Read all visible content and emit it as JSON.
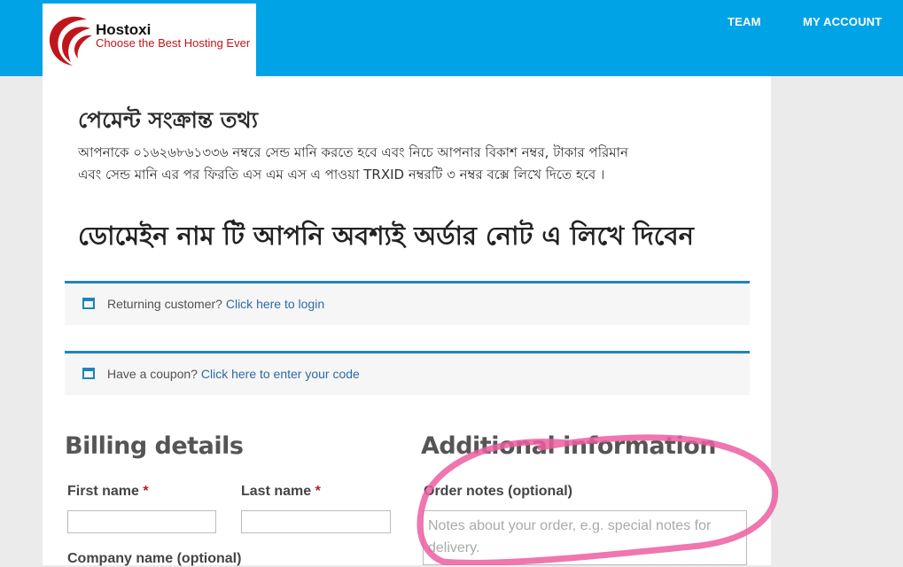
{
  "header": {
    "logo_name": "Hostoxi",
    "logo_tagline": "Choose the Best Hosting Ever",
    "nav": [
      "TEAM",
      "MY ACCOUNT"
    ]
  },
  "payment": {
    "title": "পেমেন্ট সংক্রান্ত তথ্য",
    "line1": "আপনাকে ০১৬২৬৮৬১৩৩৬ নম্বরে সেন্ড মানি করতে হবে এবং নিচে আপনার বিকাশ নম্বর, টাকার পরিমান",
    "line2": "এবং সেন্ড মানি এর পর ফিরতি এস এম এস এ পাওয়া TRXID নম্বরটি ৩ নম্বর বক্সে লিখে দিতে হবে ।",
    "domain_note": "ডোমেইন নাম টি আপনি অবশ্যই অর্ডার নোট এ লিখে দিবেন"
  },
  "notices": {
    "login_text": "Returning customer?",
    "login_link": "Click here to login",
    "coupon_text": "Have a coupon?",
    "coupon_link": "Click here to enter your code"
  },
  "billing": {
    "title": "Billing details",
    "first_name_label": "First name",
    "last_name_label": "Last name",
    "company_label": "Company name (optional)",
    "required_mark": "*"
  },
  "additional": {
    "title": "Additional information",
    "order_notes_label": "Order notes (optional)",
    "order_notes_placeholder": "Notes about your order, e.g. special notes for delivery."
  },
  "colors": {
    "header": "#00a3e6",
    "notice_border": "#1e85be",
    "annotation": "#ec5ea0",
    "required": "#b81c23"
  },
  "icons": {
    "notice_icon": "window-icon",
    "logo": "swoosh-logo-icon"
  }
}
